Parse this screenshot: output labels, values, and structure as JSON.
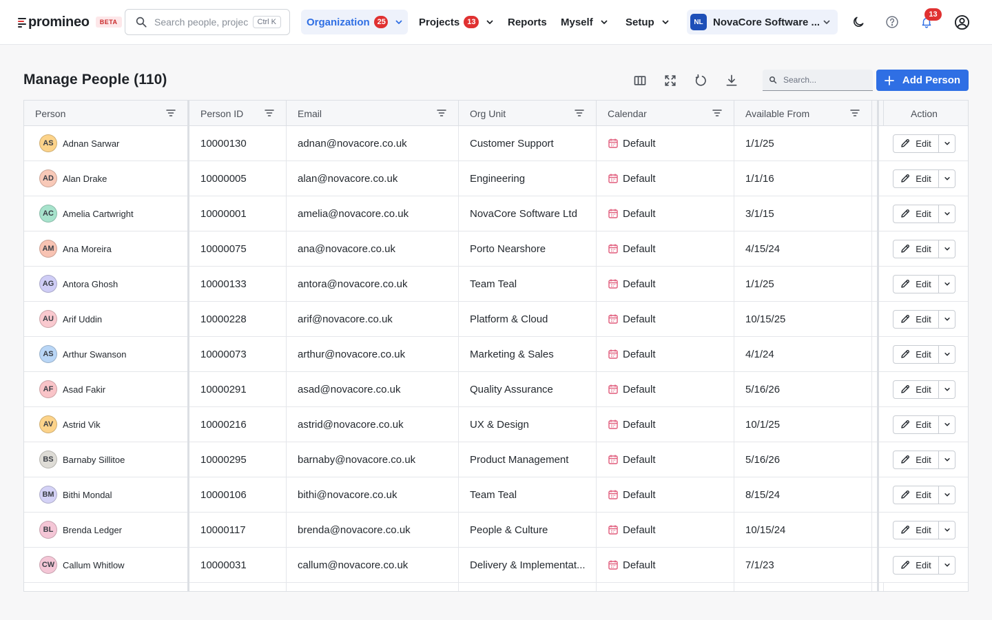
{
  "app": {
    "logo_text": "promineo",
    "beta_label": "BETA"
  },
  "global_search": {
    "placeholder": "Search people, projects",
    "shortcut": "Ctrl K"
  },
  "nav": {
    "organization": {
      "label": "Organization",
      "count": "25"
    },
    "projects": {
      "label": "Projects",
      "count": "13"
    },
    "reports": {
      "label": "Reports"
    },
    "myself": {
      "label": "Myself"
    },
    "setup": {
      "label": "Setup"
    }
  },
  "org_switcher": {
    "initials": "NL",
    "name": "NovaCore Software ..."
  },
  "notifications": {
    "count": "13"
  },
  "page": {
    "title": "Manage People (110)",
    "search_placeholder": "Search...",
    "add_label": "Add Person"
  },
  "table": {
    "columns": {
      "person": "Person",
      "person_id": "Person ID",
      "email": "Email",
      "org_unit": "Org Unit",
      "calendar": "Calendar",
      "available_from": "Available From",
      "action": "Action"
    },
    "edit_label": "Edit",
    "rows": [
      {
        "initials": "AS",
        "avatar_color": "#fcd38a",
        "name": "Adnan Sarwar",
        "id": "10000130",
        "email": "adnan@novacore.co.uk",
        "org": "Customer Support",
        "calendar": "Default",
        "available": "1/1/25"
      },
      {
        "initials": "AD",
        "avatar_color": "#f8c9b8",
        "name": "Alan Drake",
        "id": "10000005",
        "email": "alan@novacore.co.uk",
        "org": "Engineering",
        "calendar": "Default",
        "available": "1/1/16"
      },
      {
        "initials": "AC",
        "avatar_color": "#a7e3cc",
        "name": "Amelia Cartwright",
        "id": "10000001",
        "email": "amelia@novacore.co.uk",
        "org": "NovaCore Software Ltd",
        "calendar": "Default",
        "available": "3/1/15"
      },
      {
        "initials": "AM",
        "avatar_color": "#f8c3b3",
        "name": "Ana Moreira",
        "id": "10000075",
        "email": "ana@novacore.co.uk",
        "org": "Porto Nearshore",
        "calendar": "Default",
        "available": "4/15/24"
      },
      {
        "initials": "AG",
        "avatar_color": "#cfcdf6",
        "name": "Antora Ghosh",
        "id": "10000133",
        "email": "antora@novacore.co.uk",
        "org": "Team Teal",
        "calendar": "Default",
        "available": "1/1/25"
      },
      {
        "initials": "AU",
        "avatar_color": "#f9c9cf",
        "name": "Arif Uddin",
        "id": "10000228",
        "email": "arif@novacore.co.uk",
        "org": "Platform & Cloud",
        "calendar": "Default",
        "available": "10/15/25"
      },
      {
        "initials": "AS",
        "avatar_color": "#b9d6f6",
        "name": "Arthur Swanson",
        "id": "10000073",
        "email": "arthur@novacore.co.uk",
        "org": "Marketing & Sales",
        "calendar": "Default",
        "available": "4/1/24"
      },
      {
        "initials": "AF",
        "avatar_color": "#f9c4c8",
        "name": "Asad Fakir",
        "id": "10000291",
        "email": "asad@novacore.co.uk",
        "org": "Quality Assurance",
        "calendar": "Default",
        "available": "5/16/26"
      },
      {
        "initials": "AV",
        "avatar_color": "#fcd38a",
        "name": "Astrid Vik",
        "id": "10000216",
        "email": "astrid@novacore.co.uk",
        "org": "UX & Design",
        "calendar": "Default",
        "available": "10/1/25"
      },
      {
        "initials": "BS",
        "avatar_color": "#dedcd6",
        "name": "Barnaby Sillitoe",
        "id": "10000295",
        "email": "barnaby@novacore.co.uk",
        "org": "Product Management",
        "calendar": "Default",
        "available": "5/16/26"
      },
      {
        "initials": "BM",
        "avatar_color": "#d4d2f6",
        "name": "Bithi Mondal",
        "id": "10000106",
        "email": "bithi@novacore.co.uk",
        "org": "Team Teal",
        "calendar": "Default",
        "available": "8/15/24"
      },
      {
        "initials": "BL",
        "avatar_color": "#f4c6d6",
        "name": "Brenda Ledger",
        "id": "10000117",
        "email": "brenda@novacore.co.uk",
        "org": "People & Culture",
        "calendar": "Default",
        "available": "10/15/24"
      },
      {
        "initials": "CW",
        "avatar_color": "#f4c6d6",
        "name": "Callum Whitlow",
        "id": "10000031",
        "email": "callum@novacore.co.uk",
        "org": "Delivery & Implementat...",
        "calendar": "Default",
        "available": "7/1/23"
      }
    ]
  },
  "colors": {
    "accent": "#2f6fe4",
    "badge_red": "#e03131",
    "calendar_icon": "#e05a7a"
  }
}
